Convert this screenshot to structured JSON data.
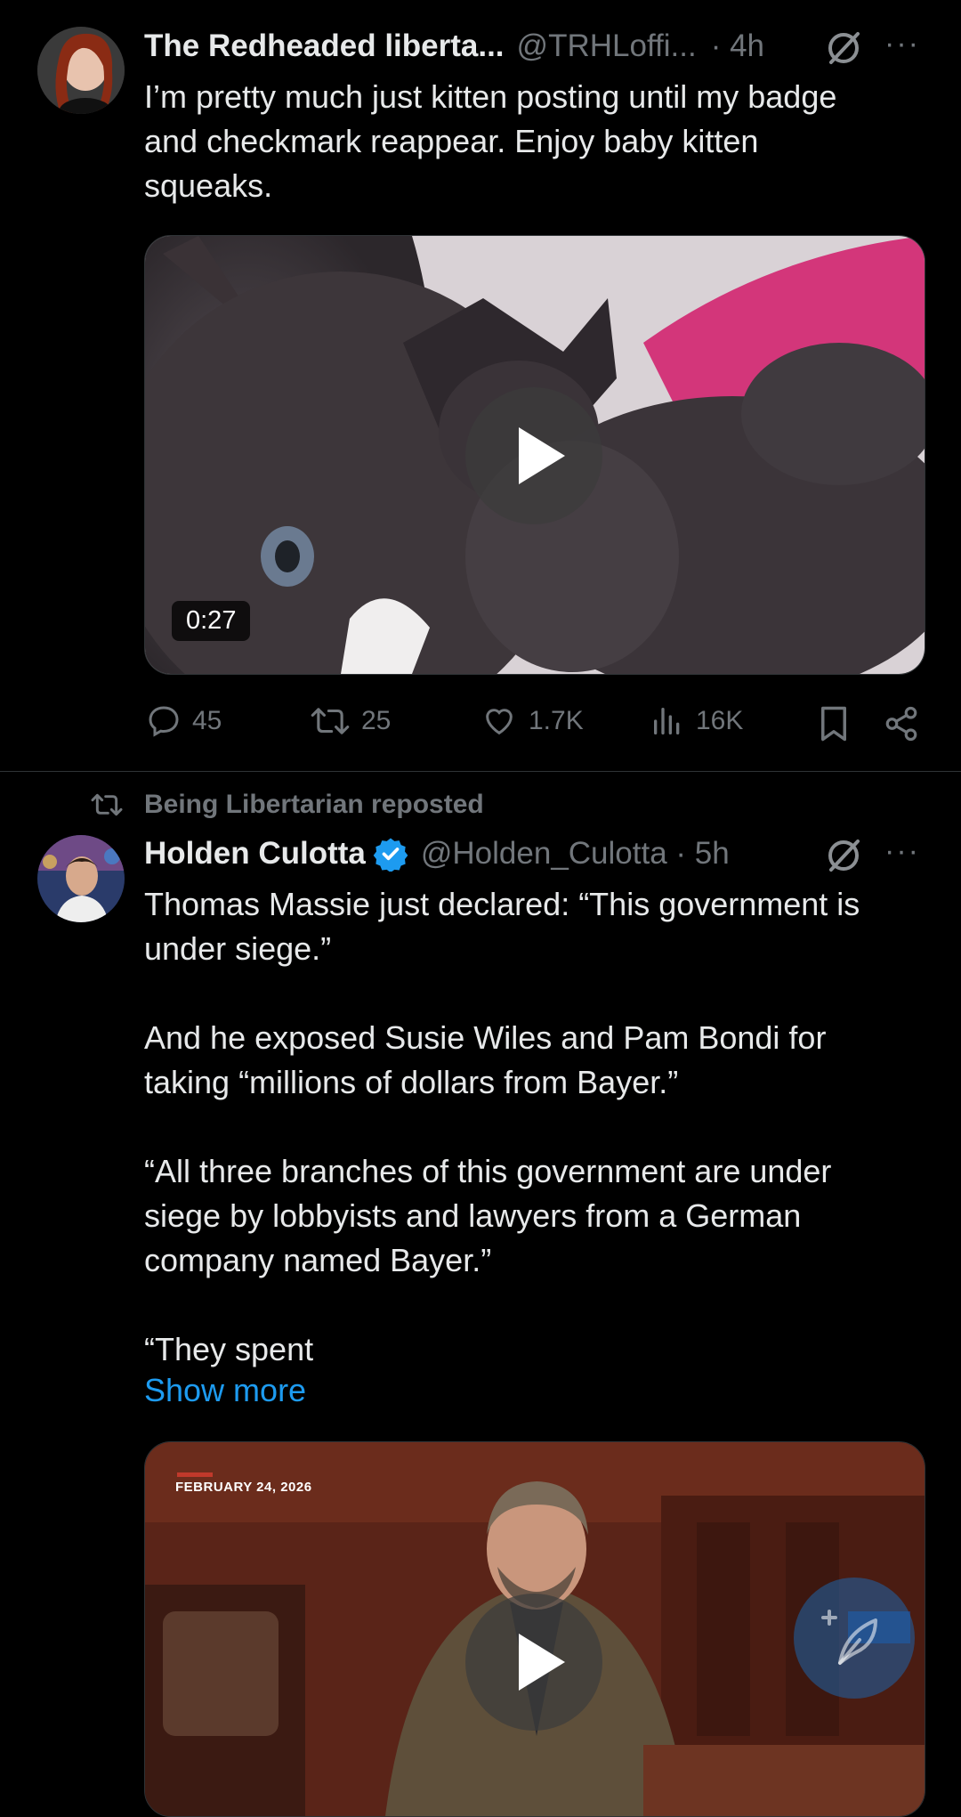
{
  "tweet1": {
    "author_name": "The Redheaded liberta...",
    "handle": "@TRHLoffi...",
    "time": "· 4h",
    "more": "···",
    "text": "I’m pretty much just kitten posting until my badge\nand checkmark reappear. Enjoy baby kitten\nsqueaks.",
    "video_duration": "0:27",
    "stats": {
      "replies": "45",
      "reposts": "25",
      "likes": "1.7K",
      "views": "16K"
    }
  },
  "tweet2": {
    "repost_label": "Being Libertarian reposted",
    "author_name": "Holden Culotta",
    "handle": "@Holden_Culotta · 5h",
    "more": "···",
    "text": "Thomas Massie just declared: “This government is\nunder siege.”\n\nAnd he exposed Susie Wiles and Pam Bondi for\ntaking “millions of dollars from Bayer.”\n\n“All three branches of this government are under\nsiege by lobbyists and lawyers from a German\ncompany named Bayer.”\n\n“They spent",
    "show_more": "Show more",
    "video_date": "FEBRUARY 24, 2026"
  },
  "colors": {
    "accent": "#1d9bf0",
    "secondary_text": "#71767b",
    "verified": "#1d9bf0"
  },
  "icons": [
    "grok-icon",
    "more-icon",
    "reply-icon",
    "repost-icon",
    "like-icon",
    "views-icon",
    "bookmark-icon",
    "share-icon",
    "verified-badge-icon",
    "play-icon",
    "compose-icon"
  ]
}
